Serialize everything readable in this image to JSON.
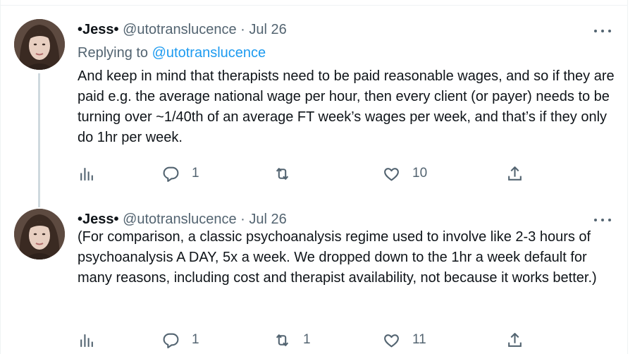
{
  "tweets": [
    {
      "author_name": "•Jess•",
      "handle": "@utotranslucence",
      "separator": "·",
      "date": "Jul 26",
      "replying_prefix": "Replying to",
      "replying_to": "@utotranslucence",
      "text": "And keep in mind that therapists need to be paid reasonable wages, and so if they are paid e.g. the average national wage per hour, then every client (or payer) needs to be turning over ~1/40th of an average FT week’s wages per week, and that’s if they only do 1hr per week.",
      "replies": "1",
      "retweets": "",
      "likes": "10"
    },
    {
      "author_name": "•Jess•",
      "handle": "@utotranslucence",
      "separator": "·",
      "date": "Jul 26",
      "text": "(For comparison, a classic psychoanalysis regime used to involve like 2-3 hours of psychoanalysis A DAY, 5x a week. We dropped down to the 1hr a week default for many reasons, including cost and therapist availability, not because it works better.)",
      "replies": "1",
      "retweets": "1",
      "likes": "11"
    }
  ],
  "icons": [
    "avatar",
    "more-icon",
    "analytics-icon",
    "reply-icon",
    "retweet-icon",
    "like-icon",
    "share-icon"
  ],
  "colors": {
    "text": "#0f1419",
    "secondary": "#536471",
    "link": "#1d9bf0",
    "thread_line": "#cfd9de",
    "border": "#eff3f4"
  }
}
